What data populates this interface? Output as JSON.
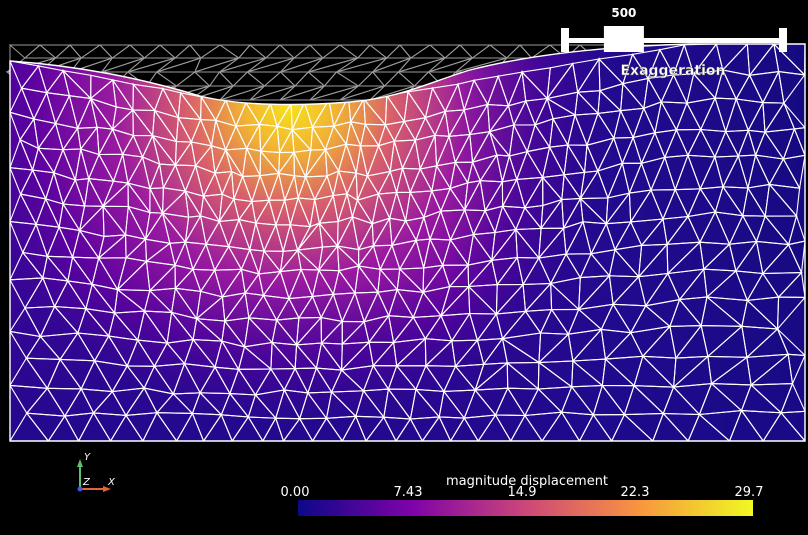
{
  "slider": {
    "value_label": "500",
    "name_label": "Exaggeration",
    "position_fraction": 0.27
  },
  "colorbar": {
    "title": "magnitude displacement",
    "ticks": [
      "0.00",
      "7.43",
      "14.9",
      "22.3",
      "29.7"
    ],
    "colors": [
      "#0d0887",
      "#7e03a8",
      "#cc4778",
      "#f89540",
      "#f0f921"
    ]
  },
  "axes": {
    "y": "Y",
    "z": "Z",
    "x": "X"
  },
  "colors": {
    "background": "#000000",
    "mesh_undeformed": "#9a9a9a",
    "mesh_deformed": "#ffffff",
    "axis_x": "#e8603c",
    "axis_y": "#5cc16a",
    "axis_z": "#3b5bd9"
  }
}
